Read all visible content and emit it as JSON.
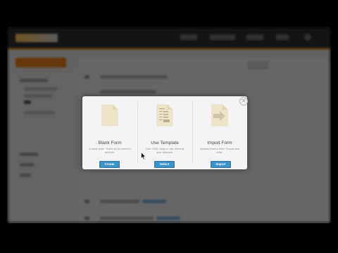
{
  "modal": {
    "close_label": "×",
    "options": [
      {
        "title": "Blank Form",
        "description": "A blank slate. That's all you need to perform.",
        "button": "Create",
        "icon": "blank-document-icon"
      },
      {
        "title": "Use Template",
        "description": "Over 1000 ready-to-use forms at your disposal.",
        "button": "Select",
        "icon": "template-document-icon"
      },
      {
        "title": "Import Form",
        "description": "Already have a form? Import and relax.",
        "button": "Import",
        "icon": "import-document-icon"
      }
    ]
  },
  "colors": {
    "accent_blue": "#3d92c9",
    "orange": "#e68a1f",
    "topbar": "#2d2d2d",
    "icon_paper": "#eee4c8"
  }
}
